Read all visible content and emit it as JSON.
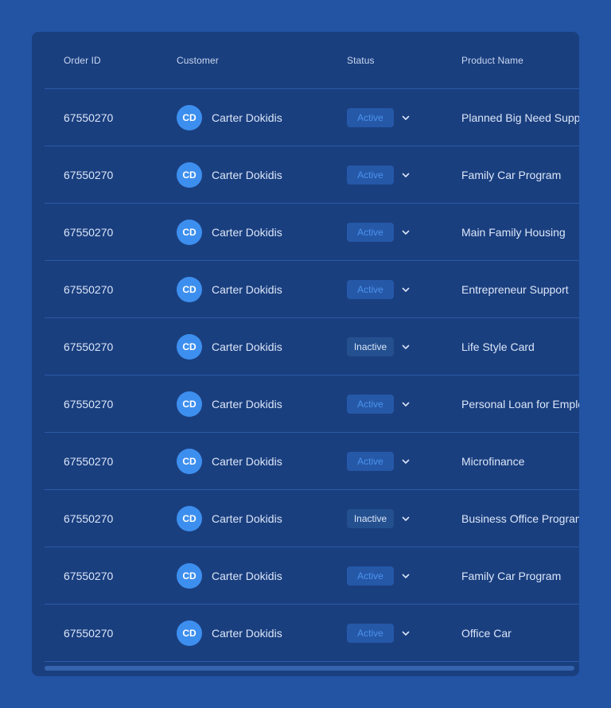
{
  "table": {
    "columns": {
      "order_id": "Order ID",
      "customer": "Customer",
      "status": "Status",
      "product_name": "Product Name"
    },
    "rows": [
      {
        "order_id": "67550270",
        "avatar_initials": "CD",
        "customer": "Carter Dokidis",
        "status": "Active",
        "product": "Planned Big Need Support"
      },
      {
        "order_id": "67550270",
        "avatar_initials": "CD",
        "customer": "Carter Dokidis",
        "status": "Active",
        "product": "Family Car Program"
      },
      {
        "order_id": "67550270",
        "avatar_initials": "CD",
        "customer": "Carter Dokidis",
        "status": "Active",
        "product": "Main Family Housing"
      },
      {
        "order_id": "67550270",
        "avatar_initials": "CD",
        "customer": "Carter Dokidis",
        "status": "Active",
        "product": "Entrepreneur Support"
      },
      {
        "order_id": "67550270",
        "avatar_initials": "CD",
        "customer": "Carter Dokidis",
        "status": "Inactive",
        "product": "Life Style Card"
      },
      {
        "order_id": "67550270",
        "avatar_initials": "CD",
        "customer": "Carter Dokidis",
        "status": "Active",
        "product": "Personal Loan for Employees"
      },
      {
        "order_id": "67550270",
        "avatar_initials": "CD",
        "customer": "Carter Dokidis",
        "status": "Active",
        "product": "Microfinance"
      },
      {
        "order_id": "67550270",
        "avatar_initials": "CD",
        "customer": "Carter Dokidis",
        "status": "Inactive",
        "product": "Business Office Program"
      },
      {
        "order_id": "67550270",
        "avatar_initials": "CD",
        "customer": "Carter Dokidis",
        "status": "Active",
        "product": "Family Car Program"
      },
      {
        "order_id": "67550270",
        "avatar_initials": "CD",
        "customer": "Carter Dokidis",
        "status": "Active",
        "product": "Office Car"
      }
    ]
  },
  "icons": {
    "status_dropdown": "chevron-down-icon"
  },
  "colors": {
    "page_background": "#2353a3",
    "card_background": "#1a3f7f",
    "avatar": "#3d8fef",
    "badge_active_text": "#4a93ec",
    "badge_active_bg": "#2658a8",
    "badge_inactive_bg": "#24508f"
  }
}
